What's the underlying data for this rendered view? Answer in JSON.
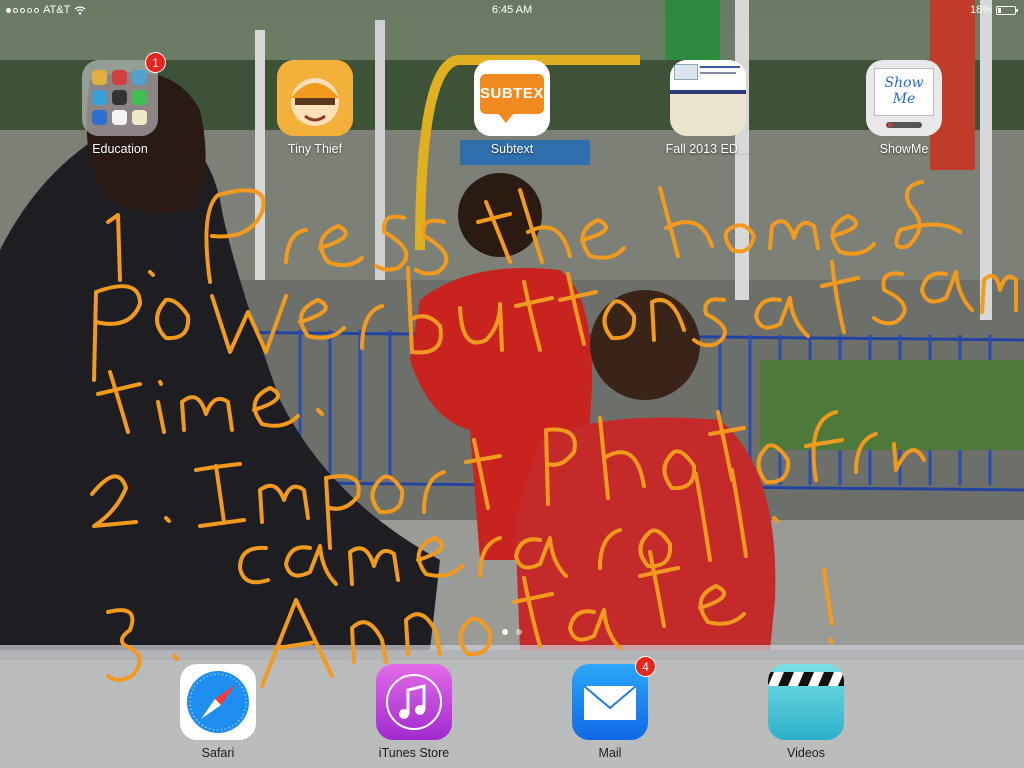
{
  "status_bar": {
    "carrier": "AT&T",
    "time": "6:45 AM",
    "battery": "18%"
  },
  "apps": [
    {
      "label": "Education",
      "badge": "1"
    },
    {
      "label": "Tiny Thief"
    },
    {
      "label": "Subtext",
      "icon_text": "SUBTEXT"
    },
    {
      "label": "Fall 2013 ED…"
    },
    {
      "label": "ShowMe",
      "icon_text": "Show Me"
    }
  ],
  "dock": [
    {
      "label": "Safari"
    },
    {
      "label": "iTunes Store"
    },
    {
      "label": "Mail",
      "badge": "4"
    },
    {
      "label": "Videos"
    }
  ],
  "annotation": {
    "color": "#f29a1e",
    "lines": [
      "1. Press the home &",
      "powerbuttons at same",
      "time.",
      "2. Import photo from",
      "camera roll.",
      "3. Annotate!"
    ]
  },
  "icons": {
    "wifi": "wifi-icon",
    "battery": "battery-icon",
    "safari": "compass-icon",
    "itunes": "music-note-icon",
    "mail": "envelope-icon",
    "videos": "clapperboard-icon"
  }
}
